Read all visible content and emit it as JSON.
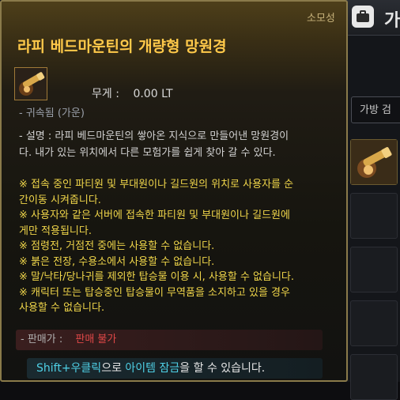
{
  "tooltip": {
    "category": "소모성",
    "title": "라피 베드마운틴의 개량형 망원경",
    "icon": "telescope-icon",
    "weight_label": "무게 :",
    "weight_value": "0.00 LT",
    "binding": "- 귀속됨 (가운)",
    "description_lines": [
      "- 설명 : 라피 베드마운틴의 쌓아온 지식으로 만들어낸 망원경이",
      "다. 내가 있는 위치에서 다른 모험가를 쉽게 찾아 갈 수 있다."
    ],
    "notes": [
      "※ 접속 중인 파티원 및 부대원이나 길드원의 위치로 사용자를 순",
      "간이동 시켜줍니다.",
      "※ 사용자와 같은 서버에 접속한 파티원 및 부대원이나 길드원에",
      "게만 적용됩니다.",
      "※ 점령전, 거점전 중에는 사용할 수 없습니다.",
      "※ 붉은 전장, 수용소에서 사용할 수 없습니다.",
      "※ 말/낙타/당나귀를 제외한 탑승물 이용 시, 사용할 수 없습니다.",
      "※ 캐릭터 또는 탑승중인 탑승물이 무역품을 소지하고 있을 경우",
      "사용할 수 없습니다."
    ],
    "price_label": "- 판매가 :",
    "price_value": "판매 불가",
    "hint_key": "Shift+우클릭",
    "hint_mid": "으로 ",
    "hint_kw": "아이템 잠금",
    "hint_end": "을 할 수 있습니다."
  },
  "inventory": {
    "header_icon": "bag-icon",
    "title": "가",
    "search_placeholder": "가방 검",
    "item_icon": "telescope-icon"
  },
  "colors": {
    "title": "#ffc94a",
    "notes": "#f0d64a",
    "price_value": "#e04848",
    "hint_keyword": "#4fd0e6"
  }
}
